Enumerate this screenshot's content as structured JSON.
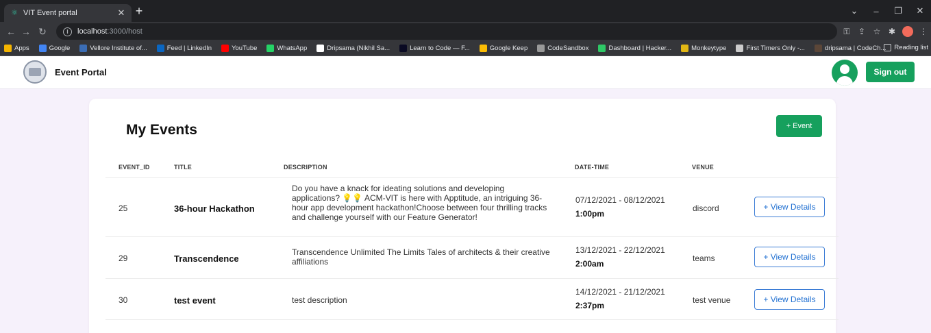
{
  "browser": {
    "tab_title": "VIT Event portal",
    "url_host": "localhost",
    "url_rest": ":3000/host",
    "bookmarks": [
      {
        "label": "Apps",
        "icon": "apps-grid-icon",
        "color": "#f4b400"
      },
      {
        "label": "Google",
        "icon": "google-icon",
        "color": "#4285f4"
      },
      {
        "label": "Vellore Institute of...",
        "icon": "vit-icon",
        "color": "#3b6db5"
      },
      {
        "label": "Feed | LinkedIn",
        "icon": "linkedin-icon",
        "color": "#0a66c2"
      },
      {
        "label": "YouTube",
        "icon": "youtube-icon",
        "color": "#ff0000"
      },
      {
        "label": "WhatsApp",
        "icon": "whatsapp-icon",
        "color": "#25d366"
      },
      {
        "label": "Dripsama (Nikhil Sa...",
        "icon": "github-icon",
        "color": "#ffffff"
      },
      {
        "label": "Learn to Code — F...",
        "icon": "freecodecamp-icon",
        "color": "#0a0a23"
      },
      {
        "label": "Google Keep",
        "icon": "google-keep-icon",
        "color": "#fbbc04"
      },
      {
        "label": "CodeSandbox",
        "icon": "codesandbox-icon",
        "color": "#999999"
      },
      {
        "label": "Dashboard | Hacker...",
        "icon": "hackerrank-icon",
        "color": "#2ec866"
      },
      {
        "label": "Monkeytype",
        "icon": "monkeytype-icon",
        "color": "#e2b714"
      },
      {
        "label": "First Timers Only -...",
        "icon": "firsttimers-icon",
        "color": "#cccccc"
      },
      {
        "label": "dripsama | CodeCh...",
        "icon": "codechef-icon",
        "color": "#5b4638"
      }
    ],
    "reading_list": "Reading list"
  },
  "header": {
    "app_title": "Event Portal",
    "signout_label": "Sign out"
  },
  "main": {
    "title": "My Events",
    "add_event_label": "+ Event",
    "columns": [
      "EVENT_ID",
      "TITLE",
      "DESCRIPTION",
      "DATE-TIME",
      "VENUE"
    ],
    "rows": [
      {
        "id": "25",
        "title": "36-hour Hackathon",
        "description": "Do you have a knack for ideating solutions and developing applications? 💡💡 ACM-VIT is here with Apptitude, an intriguing 36-hour app development hackathon!Choose between four thrilling tracks and challenge yourself with our Feature Generator!",
        "date_range": "07/12/2021 - 08/12/2021",
        "time": "1:00pm",
        "venue": "discord",
        "action": "+ View Details"
      },
      {
        "id": "29",
        "title": "Transcendence",
        "description": "Transcendence Unlimited The Limits Tales of architects & their creative affiliations",
        "date_range": "13/12/2021 - 22/12/2021",
        "time": "2:00am",
        "venue": "teams",
        "action": "+ View Details"
      },
      {
        "id": "30",
        "title": "test event",
        "description": "test description",
        "date_range": "14/12/2021 - 21/12/2021",
        "time": "2:37pm",
        "venue": "test venue",
        "action": "+ View Details"
      }
    ]
  },
  "colors": {
    "primary_green": "#16a05d",
    "link_blue": "#1f6fd1",
    "page_bg": "#f6f1fb"
  }
}
